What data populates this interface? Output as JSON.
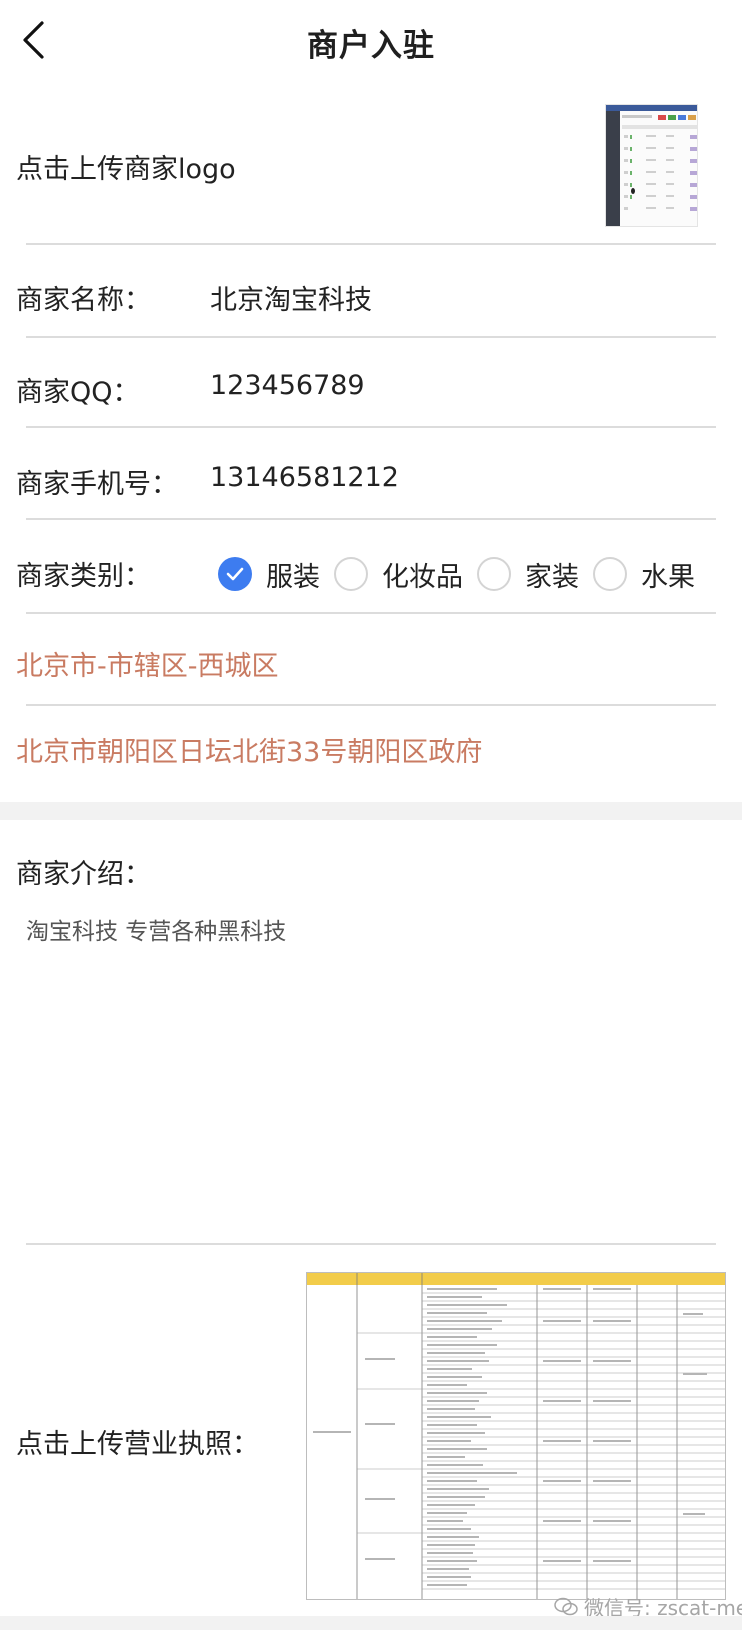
{
  "header": {
    "title": "商户入驻"
  },
  "logo_upload": {
    "label": "点击上传商家logo"
  },
  "fields": {
    "name": {
      "label": "商家名称：",
      "value": "北京淘宝科技"
    },
    "qq": {
      "label": "商家QQ：",
      "value": "123456789"
    },
    "phone": {
      "label": "商家手机号：",
      "value": "13146581212"
    }
  },
  "category": {
    "label": "商家类别：",
    "options": [
      {
        "label": "服装",
        "checked": true
      },
      {
        "label": "化妆品",
        "checked": false
      },
      {
        "label": "家装",
        "checked": false
      },
      {
        "label": "水果",
        "checked": false
      }
    ]
  },
  "region": "北京市-市辖区-西城区",
  "address": "北京市朝阳区日坛北街33号朝阳区政府",
  "intro": {
    "label": "商家介绍：",
    "value": "淘宝科技 专营各种黑科技"
  },
  "license_upload": {
    "label": "点击上传营业执照："
  },
  "watermark": "微信号: zscat-me",
  "colors": {
    "accent": "#3d7cf0",
    "address": "#c97b62",
    "divider": "#dcdcdc"
  }
}
